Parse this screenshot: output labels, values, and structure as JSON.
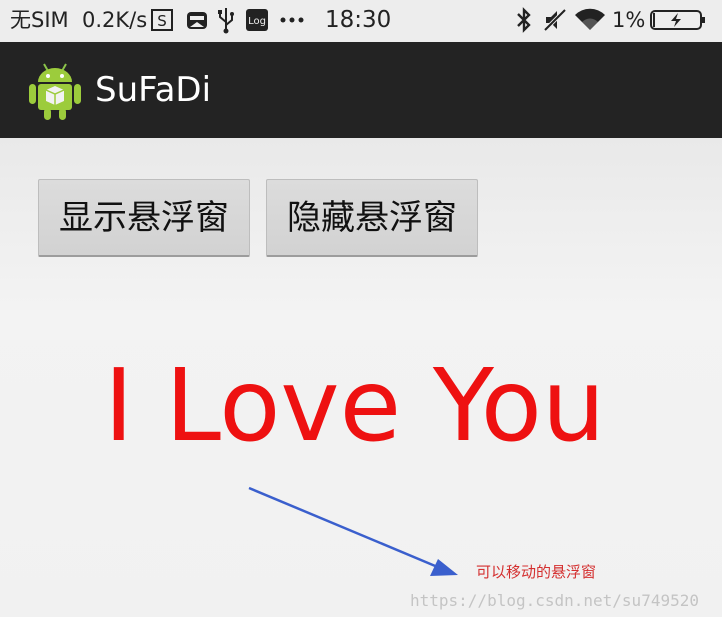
{
  "status_bar": {
    "carrier": "无SIM",
    "speed": "0.2K/s",
    "time": "18:30",
    "battery": "1%",
    "icons": [
      "screenshot-icon",
      "vivo-app-icon",
      "usb-icon",
      "log-icon",
      "more-icon",
      "bluetooth-icon",
      "mute-icon",
      "wifi-icon",
      "battery-charging-icon"
    ]
  },
  "action_bar": {
    "title": "SuFaDi",
    "icon": "android-icon"
  },
  "content": {
    "show_button": "显示悬浮窗",
    "hide_button": "隐藏悬浮窗",
    "love_text": "I Love You",
    "float_label": "可以移动的悬浮窗",
    "watermark": "https://blog.csdn.net/su749520"
  },
  "colors": {
    "action_bar_bg": "#232323",
    "love_text": "#ee1111",
    "arrow": "#3a5fcd",
    "float_label": "#d43030"
  }
}
